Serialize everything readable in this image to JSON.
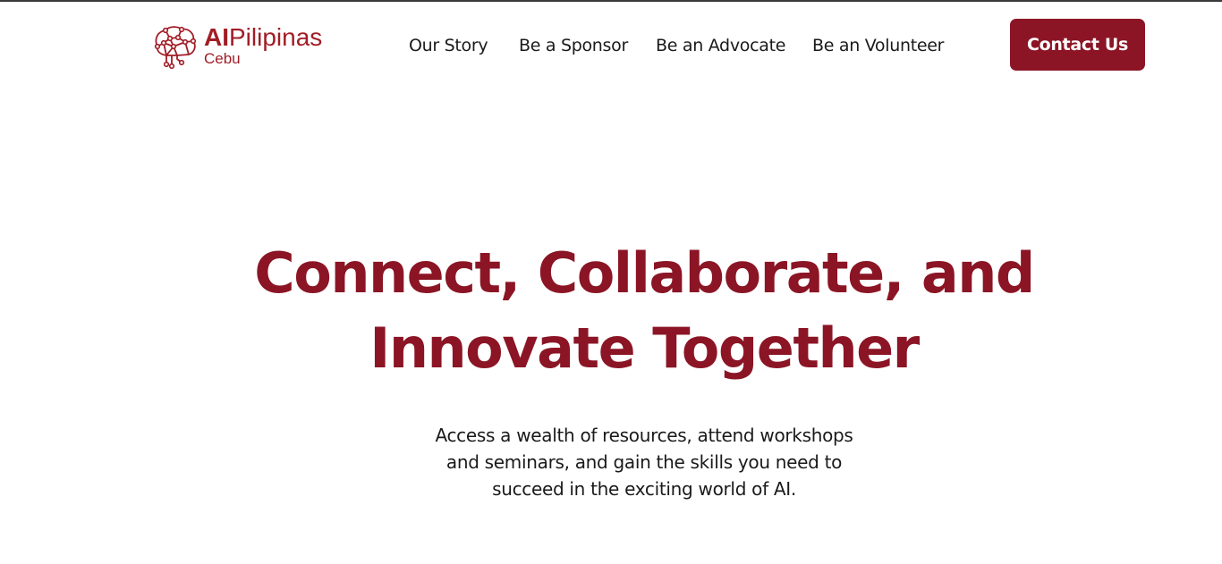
{
  "brand": {
    "title_bold": "AI",
    "title_regular": "Pilipinas",
    "subtitle": "Cebu",
    "color": "#a11d26"
  },
  "nav": {
    "items": [
      {
        "label": "Our Story"
      },
      {
        "label": "Be a Sponsor"
      },
      {
        "label": "Be an Advocate"
      },
      {
        "label": "Be an Volunteer"
      }
    ],
    "contact_label": "Contact Us"
  },
  "hero": {
    "title_line1": "Connect, Collaborate, and",
    "title_line2": "Innovate Together",
    "description_lines": [
      "Access a wealth of resources, attend workshops",
      "and seminars, and gain the skills you need to",
      "succeed in the exciting world of AI."
    ]
  },
  "icons": {
    "logo": "brain-circuit-icon"
  },
  "colors": {
    "accent": "#8b1525",
    "text": "#1a1a1a",
    "background": "#ffffff"
  }
}
